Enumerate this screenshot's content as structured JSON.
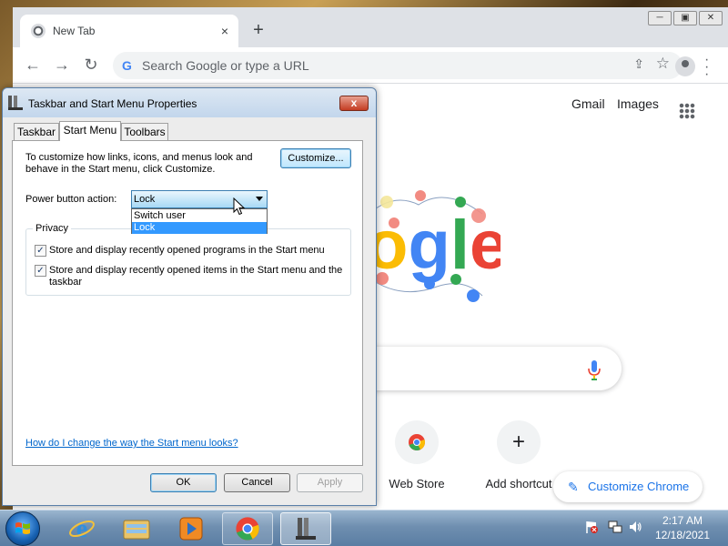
{
  "browser": {
    "tab_title": "New Tab",
    "tab_close": "×",
    "new_tab": "+",
    "omnibox_placeholder": "Search Google or type a URL",
    "omnibox_icon": "G",
    "top_links": [
      "Gmail",
      "Images"
    ],
    "shortcuts": [
      {
        "label": "Web Store",
        "icon": "chrome-web-store-icon"
      },
      {
        "label": "Add shortcut",
        "icon": "plus-icon",
        "glyph": "+"
      }
    ],
    "customize_chrome": "Customize Chrome",
    "doodle_text": "ogle"
  },
  "dialog": {
    "title": "Taskbar and Start Menu Properties",
    "close_glyph": "x",
    "tabs": [
      "Taskbar",
      "Start Menu",
      "Toolbars"
    ],
    "active_tab": "Start Menu",
    "description": "To customize how links, icons, and menus look and behave in the Start menu, click Customize.",
    "customize_button": "Customize...",
    "power_label": "Power button action:",
    "power_value": "Lock",
    "power_options": [
      "Switch user",
      "Lock"
    ],
    "power_selected_option": "Lock",
    "privacy_legend": "Privacy",
    "privacy_options": [
      {
        "label": "Store and display recently opened programs in the Start menu",
        "checked": true
      },
      {
        "label": "Store and display recently opened items in the Start menu and the taskbar",
        "checked": true
      }
    ],
    "help_link": "How do I change the way the Start menu looks?",
    "buttons": {
      "ok": "OK",
      "cancel": "Cancel",
      "apply": "Apply"
    }
  },
  "taskbar": {
    "time": "2:17 AM",
    "date": "12/18/2021",
    "pinned": [
      "internet-explorer-icon",
      "windows-explorer-icon",
      "media-player-icon",
      "chrome-icon",
      "taskbar-properties-icon"
    ]
  },
  "colors": {
    "chrome_blue": "#1a73e8",
    "selection": "#3399ff",
    "link": "#0066cc"
  }
}
